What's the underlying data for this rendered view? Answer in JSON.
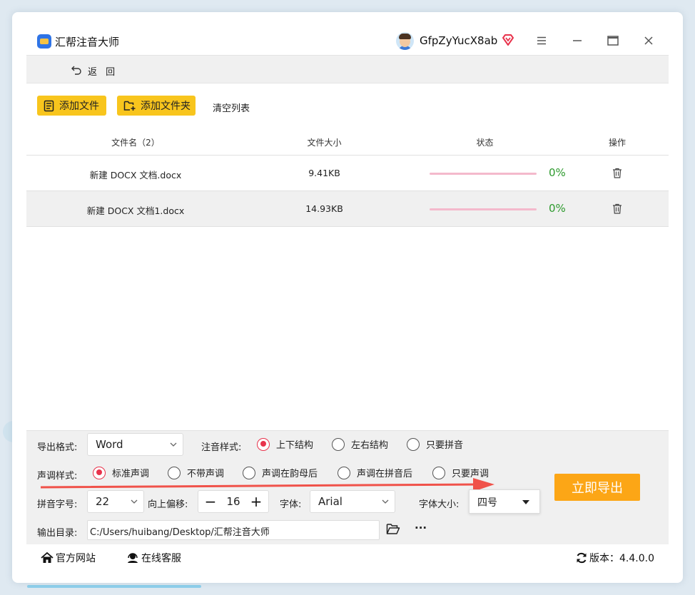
{
  "app": {
    "title": "汇帮注音大师"
  },
  "user": {
    "name": "GfpZyYucX8ab"
  },
  "nav": {
    "back_label": "返 回"
  },
  "toolbar": {
    "add_file": "添加文件",
    "add_folder": "添加文件夹",
    "clear_list": "清空列表"
  },
  "table": {
    "headers": {
      "name": "文件名（2）",
      "size": "文件大小",
      "status": "状态",
      "action": "操作"
    },
    "rows": [
      {
        "name": "新建 DOCX 文档.docx",
        "size": "9.41KB",
        "progress": "0%"
      },
      {
        "name": "新建 DOCX 文档1.docx",
        "size": "14.93KB",
        "progress": "0%"
      }
    ]
  },
  "settings": {
    "export_format": {
      "label": "导出格式:",
      "value": "Word"
    },
    "annotation_style": {
      "label": "注音样式:",
      "options": [
        "上下结构",
        "左右结构",
        "只要拼音"
      ],
      "selected": "上下结构"
    },
    "tone_style": {
      "label": "声调样式:",
      "options": [
        "标准声调",
        "不带声调",
        "声调在韵母后",
        "声调在拼音后",
        "只要声调"
      ],
      "selected": "标准声调"
    },
    "pinyin_size": {
      "label": "拼音字号:",
      "value": "22"
    },
    "offset": {
      "label": "向上偏移:",
      "value": "16",
      "minus": "−",
      "plus": "+"
    },
    "font": {
      "label": "字体:",
      "value": "Arial"
    },
    "font_size": {
      "label": "字体大小:",
      "value": "四号"
    },
    "output_dir": {
      "label": "输出目录:",
      "value": "C:/Users/huibang/Desktop/汇帮注音大师",
      "more": "···"
    },
    "export_button": "立即导出"
  },
  "footer": {
    "website": "官方网站",
    "support": "在线客服",
    "version": "版本：4.4.0.0"
  },
  "colors": {
    "accent": "#f8c51d",
    "export": "#fca616",
    "radio": "#e8334c",
    "progress_track": "#f4b9cc",
    "percent": "#2d9a2d"
  }
}
